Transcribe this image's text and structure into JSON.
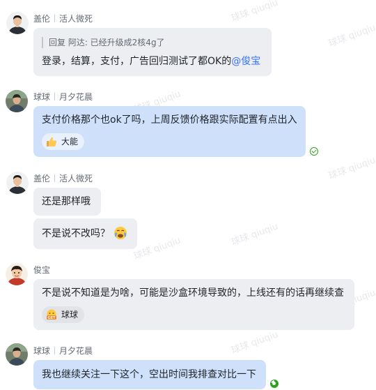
{
  "watermark": "球球 qiuqiu",
  "messages": [
    {
      "sender": "盖伦",
      "tag": "活人微死",
      "quote": "回复 阿达: 已经升级成2核4g了",
      "text": "登录，结算，支付，广告回归测试了都OK的",
      "mention": "@俊宝"
    },
    {
      "sender": "球球",
      "tag": "月夕花晨",
      "text": "支付价格那个也ok了吗，上周反馈价格跟实际配置有点出入",
      "reaction": {
        "emoji": "thumbs-up",
        "user": "大能"
      }
    },
    {
      "sender": "盖伦",
      "tag": "活人微死",
      "texts": [
        "还是那样哦",
        "不是说不改吗？"
      ]
    },
    {
      "sender": "俊宝",
      "text": "不是说不知道是为啥，可能是沙盒环境导致的，上线还有的话再继续查",
      "reaction": {
        "emoji": "get-emoji",
        "user": "球球"
      }
    },
    {
      "sender": "球球",
      "tag": "月夕花晨",
      "text": "我也继续关注一下这个，空出时间我排查对比一下"
    }
  ]
}
